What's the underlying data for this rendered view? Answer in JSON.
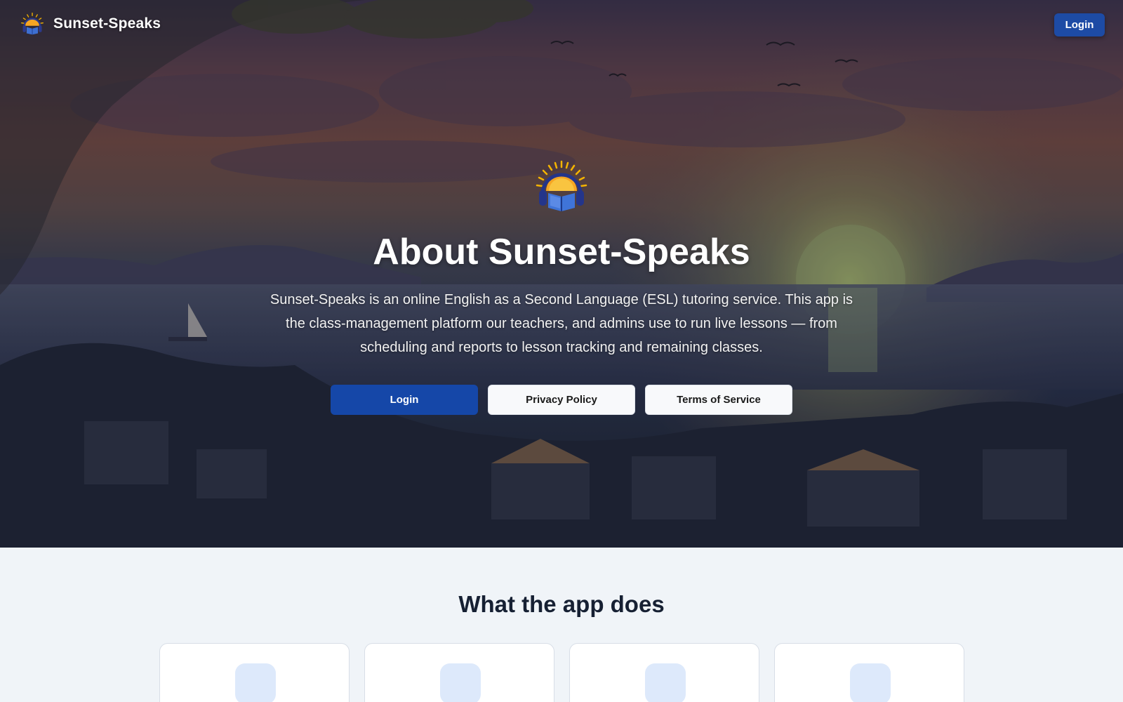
{
  "brand": {
    "name": "Sunset-Speaks",
    "logo_icon": "sunrise-headphones-book-icon"
  },
  "nav": {
    "login_label": "Login"
  },
  "hero": {
    "title": "About Sunset-Speaks",
    "description": "Sunset-Speaks is an online English as a Second Language (ESL) tutoring service. This app is the class-management platform our teachers, and admins use to run live lessons — from scheduling and reports to lesson tracking and remaining classes.",
    "buttons": {
      "login": "Login",
      "privacy": "Privacy Policy",
      "terms": "Terms of Service"
    }
  },
  "features": {
    "title": "What the app does",
    "cards": [
      {
        "icon": "feature-icon"
      },
      {
        "icon": "feature-icon"
      },
      {
        "icon": "feature-icon"
      },
      {
        "icon": "feature-icon"
      }
    ]
  },
  "colors": {
    "primary": "#1547a8",
    "nav_button": "#1d4ba5",
    "page_bg": "#f0f4f8",
    "icon_tile": "#dde9fb",
    "heading": "#162033"
  }
}
